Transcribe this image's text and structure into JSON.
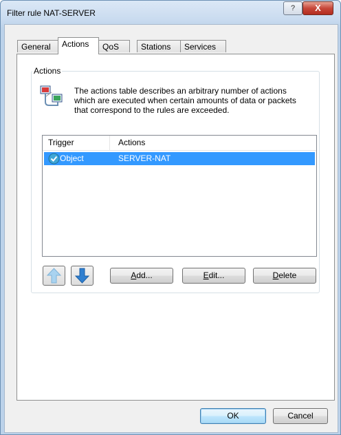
{
  "window": {
    "title": "Filter rule NAT-SERVER",
    "help_label": "?",
    "close_label": "X"
  },
  "tabs": [
    {
      "label": "General"
    },
    {
      "label": "Actions"
    },
    {
      "label": "QoS"
    },
    {
      "label": "Stations"
    },
    {
      "label": "Services"
    }
  ],
  "active_tab": "Actions",
  "actions_group": {
    "label": "Actions",
    "description": "The actions table describes an arbitrary number of actions which are executed when certain amounts of data or packets that correspond to the rules are exceeded."
  },
  "table": {
    "columns": [
      "Trigger",
      "Actions"
    ],
    "rows": [
      {
        "trigger": "Object",
        "action": "SERVER-NAT",
        "selected": true
      }
    ]
  },
  "buttons": {
    "add": {
      "accel": "A",
      "rest": "dd..."
    },
    "edit": {
      "accel": "E",
      "rest": "dit..."
    },
    "delete": {
      "accel": "D",
      "rest": "elete"
    },
    "ok": "OK",
    "cancel": "Cancel"
  },
  "icons": {
    "move_up": "arrow-up-icon",
    "move_down": "arrow-down-icon",
    "info": "network-actions-icon",
    "row_status": "check-circle-icon"
  },
  "colors": {
    "selection": "#3399ff",
    "title_close": "#c7473a"
  }
}
